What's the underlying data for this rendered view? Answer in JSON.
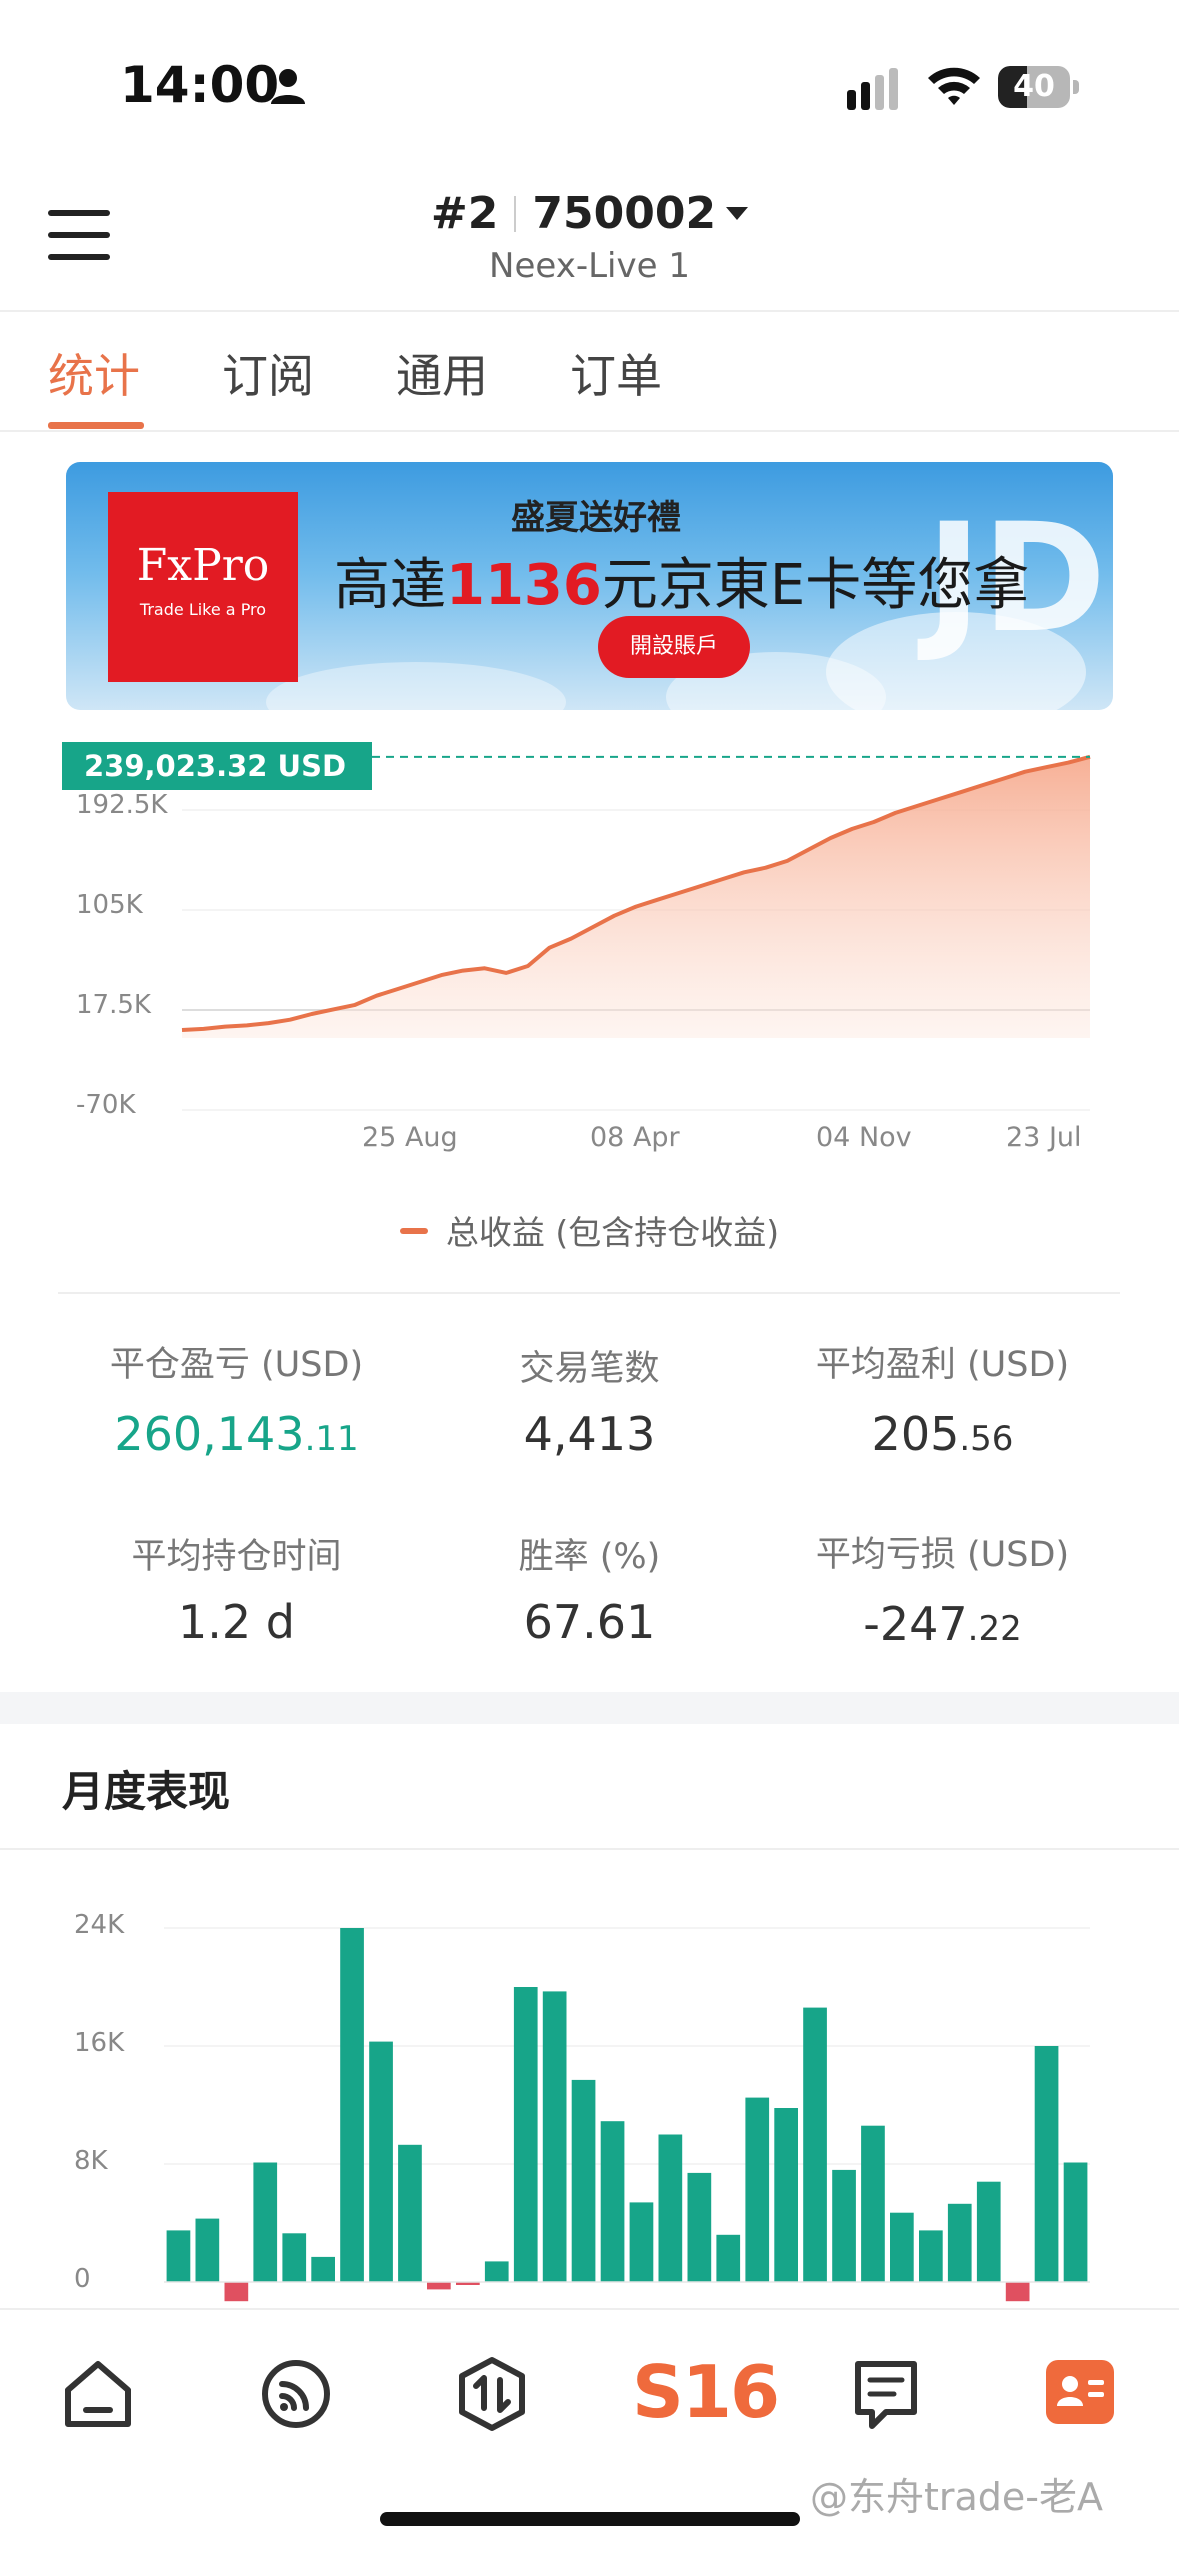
{
  "status_bar": {
    "time": "14:00",
    "battery": "40",
    "battery_level": 0.4
  },
  "header": {
    "account_index": "#2",
    "account_number": "750002",
    "server": "Neex-Live 1"
  },
  "tabs": [
    {
      "label": "统计",
      "active": true
    },
    {
      "label": "订阅",
      "active": false
    },
    {
      "label": "通用",
      "active": false
    },
    {
      "label": "订单",
      "active": false
    }
  ],
  "banner": {
    "logo": "FxPro",
    "logo_tagline": "Trade Like a Pro",
    "headline": "盛夏送好禮",
    "main_pre": "高達",
    "main_number": "1136",
    "main_post": "元京東E卡等您拿",
    "button": "開設賬戶",
    "watermark_letters": "JD"
  },
  "equity_chart": {
    "current_value_label": "239,023.32 USD",
    "legend": "总收益 (包含持仓收益)"
  },
  "chart_data": [
    {
      "type": "area",
      "title": "",
      "y_ticks": [
        "192.5K",
        "105K",
        "17.5K",
        "-70K"
      ],
      "x_ticks": [
        "25 Aug",
        "08 Apr",
        "04 Nov",
        "23 Jul"
      ],
      "ylim": [
        -70000,
        239023
      ],
      "current_value": 239023.32,
      "series": [
        {
          "name": "总收益 (包含持仓收益)",
          "color": "#e8734a",
          "values": [
            0,
            1000,
            3000,
            4000,
            6000,
            9000,
            14000,
            18000,
            22000,
            30000,
            36000,
            42000,
            48000,
            52000,
            54000,
            50000,
            56000,
            72000,
            80000,
            90000,
            100000,
            108000,
            114000,
            120000,
            126000,
            132000,
            138000,
            142000,
            148000,
            158000,
            168000,
            176000,
            182000,
            190000,
            196000,
            202000,
            208000,
            214000,
            220000,
            226000,
            230000,
            234000,
            239023
          ]
        }
      ],
      "grid": true
    },
    {
      "type": "bar",
      "title": "月度表现",
      "y_ticks": [
        "24K",
        "16K",
        "8K",
        "0"
      ],
      "ylim": [
        -1500,
        24000
      ],
      "series": [
        {
          "name": "",
          "values": [
            3500,
            4300,
            -1300,
            8100,
            3300,
            1700,
            24000,
            16300,
            9300,
            -500,
            -150,
            1400,
            20000,
            19700,
            13700,
            10900,
            5400,
            10000,
            7400,
            3200,
            12500,
            11800,
            18600,
            7600,
            10600,
            4700,
            3500,
            5300,
            6800,
            -1300,
            16000,
            8100
          ]
        }
      ],
      "colors": {
        "positive": "#17a589",
        "negative": "#e05060"
      },
      "grid": true
    }
  ],
  "stats": [
    {
      "label": "平仓盈亏 (USD)",
      "int": "260,143",
      "dec": ".11",
      "green": true
    },
    {
      "label": "交易笔数",
      "int": "4,413",
      "dec": "",
      "green": false
    },
    {
      "label": "平均盈利 (USD)",
      "int": "205",
      "dec": ".56",
      "green": false
    },
    {
      "label": "平均持仓时间",
      "int": "1.2 d",
      "dec": "",
      "green": false
    },
    {
      "label": "胜率 (%)",
      "int": "67.61",
      "dec": "",
      "green": false
    },
    {
      "label": "平均亏损 (USD)",
      "int": "-247",
      "dec": ".22",
      "green": false
    }
  ],
  "monthly": {
    "title": "月度表现"
  },
  "bottom_nav": {
    "s16_label": "S16",
    "watermark": "@东舟trade-老A"
  }
}
